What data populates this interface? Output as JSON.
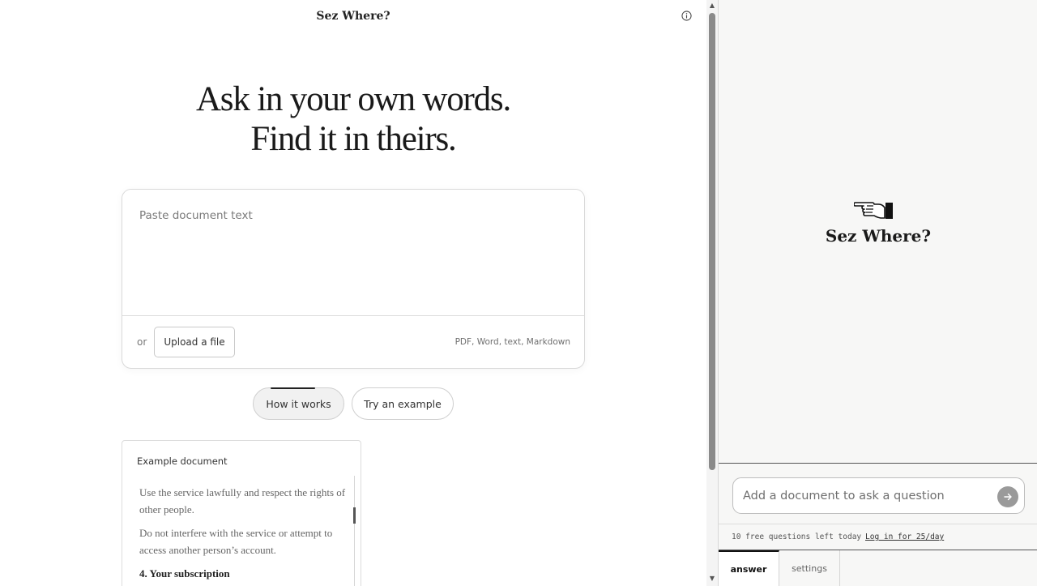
{
  "app": {
    "title": "Sez Where?"
  },
  "hero": {
    "line1": "Ask in your own words.",
    "line2": "Find it in theirs."
  },
  "document_input": {
    "placeholder": "Paste document text",
    "or_label": "or",
    "upload_label": "Upload a file",
    "formats_hint": "PDF, Word, text, Markdown"
  },
  "actions": {
    "how_it_works": "How it works",
    "try_example": "Try an example"
  },
  "example": {
    "title": "Example document",
    "paragraphs": [
      "Use the service lawfully and respect the rights of other people.",
      "Do not interfere with the service or attempt to access another person’s account."
    ],
    "section_heading": "4. Your subscription"
  },
  "assistant": {
    "brand": "Sez Where?",
    "question_placeholder": "Add a document to ask a question",
    "quota_text": "10 free questions left today",
    "login_text": "Log in for 25/day",
    "tabs": [
      {
        "label": "answer",
        "active": true
      },
      {
        "label": "settings",
        "active": false
      }
    ]
  },
  "icons": {
    "info": "info-circle-icon",
    "hand": "pointing-hand-icon",
    "send": "arrow-right-icon"
  },
  "colors": {
    "send_button": "#9a9a9a",
    "panel_background": "#f7f7f6"
  }
}
